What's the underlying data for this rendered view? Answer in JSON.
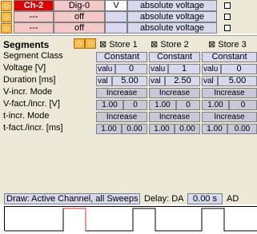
{
  "channels": [
    {
      "name": "Ch-2",
      "dig": "Dig-0",
      "unit": "V",
      "mode": "absolute voltage"
    },
    {
      "name": "---",
      "dig": "off",
      "unit": "",
      "mode": "absolute voltage"
    },
    {
      "name": "---",
      "dig": "off",
      "unit": "",
      "mode": "absolute voltage"
    }
  ],
  "segments": {
    "title": "Segments",
    "stores": [
      "Store 1",
      "Store 2",
      "Store 3"
    ],
    "rows": {
      "segment_class": {
        "label": "Segment Class",
        "values": [
          "Constant",
          "Constant",
          "Constant"
        ]
      },
      "voltage": {
        "label": "Voltage [V]",
        "prefix": "valu",
        "values": [
          "0",
          "1",
          "0"
        ]
      },
      "duration": {
        "label": "Duration [ms]",
        "prefix": "val",
        "values": [
          "5.00",
          "2.50",
          "5.00"
        ]
      },
      "v_incr_mode": {
        "label": "V-incr. Mode",
        "values": [
          "Increase",
          "Increase",
          "Increase"
        ]
      },
      "v_fact": {
        "label": "V-fact./incr. [V]",
        "values": [
          [
            "1.00",
            "0"
          ],
          [
            "1.00",
            "0"
          ],
          [
            "1.00",
            "0"
          ]
        ]
      },
      "t_incr_mode": {
        "label": "t-incr. Mode",
        "values": [
          "Increase",
          "Increase",
          "Increase"
        ]
      },
      "t_fact": {
        "label": "t-fact./incr. [ms]",
        "values": [
          [
            "1.00",
            "0.00"
          ],
          [
            "1.00",
            "0.00"
          ],
          [
            "1.00",
            "0.00"
          ]
        ]
      }
    }
  },
  "draw_bar": {
    "draw_label": "Draw: Active Channel, all Sweeps",
    "delay_label": "Delay: DA",
    "delay_value": "0.00 s",
    "trailing": "AD"
  }
}
